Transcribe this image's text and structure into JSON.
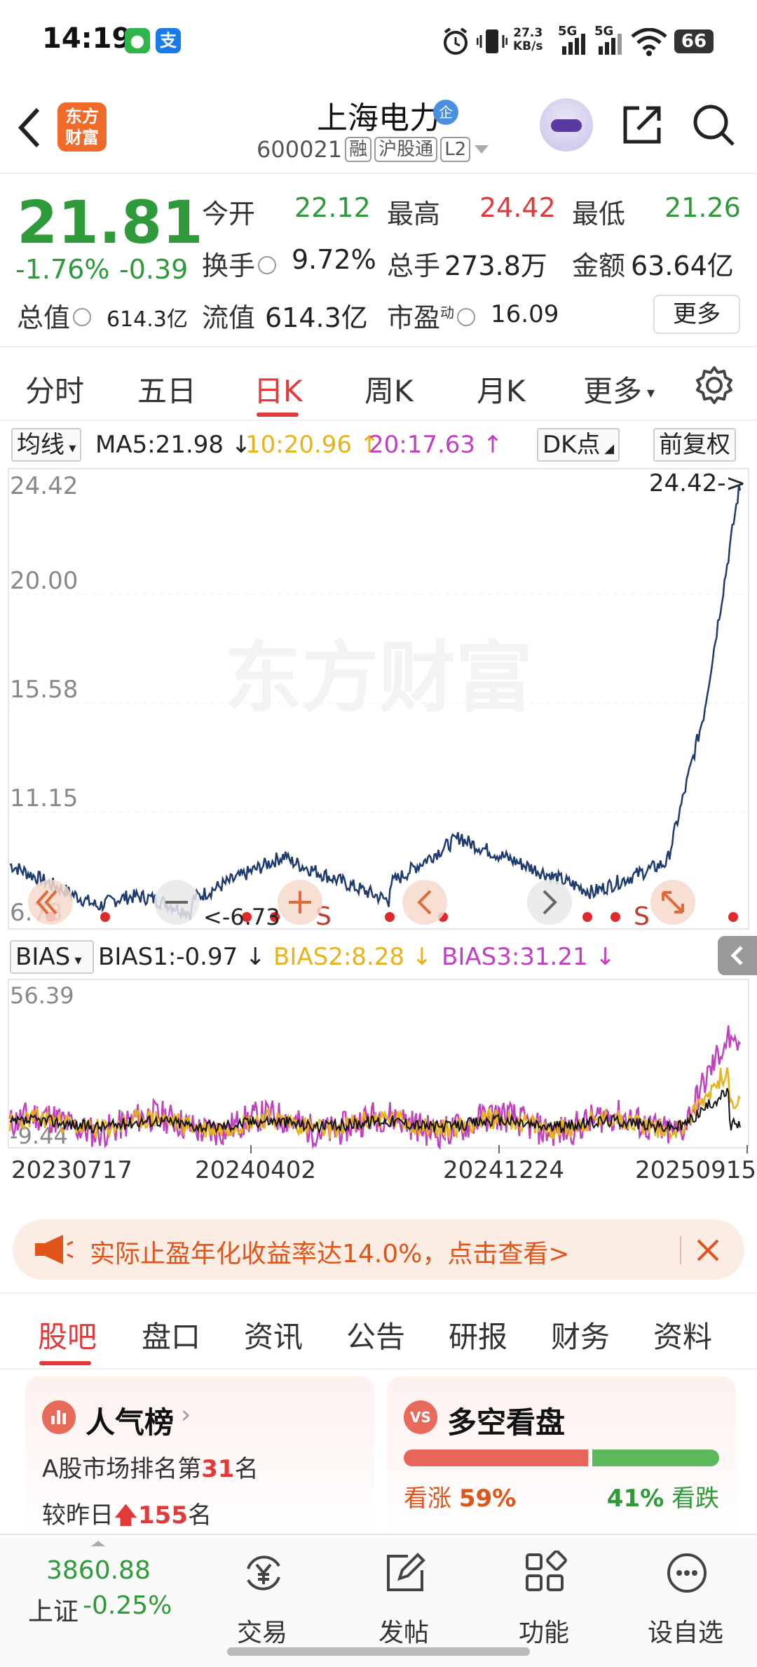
{
  "status_bar": {
    "time": "14:19",
    "app_icons": [
      "wechat-icon",
      "alipay-icon"
    ],
    "net_speed_value": "27.3",
    "net_speed_unit": "KB/s",
    "signal1": "5G",
    "signal2": "5G",
    "battery": "66"
  },
  "header": {
    "brand_logo_line1": "东方",
    "brand_logo_line2": "财富",
    "stock_name": "上海电力",
    "qi_badge": "企",
    "stock_code": "600021",
    "tags": [
      "融",
      "沪股通",
      "L2"
    ]
  },
  "quote": {
    "price": "21.81",
    "change_pct": "-1.76%",
    "change_amt": "-0.39",
    "open_label": "今开",
    "open_value": "22.12",
    "high_label": "最高",
    "high_value": "24.42",
    "low_label": "最低",
    "low_value": "21.26",
    "turnover_label": "换手",
    "turnover_value": "9.72%",
    "volume_label": "总手",
    "volume_value": "273.8万",
    "amount_label": "金额",
    "amount_value": "63.64亿",
    "mktcap_label": "总值",
    "mktcap_value": "614.3亿",
    "float_label": "流值",
    "float_value": "614.3亿",
    "pe_label": "市盈",
    "pe_sup": "动",
    "pe_value": "16.09",
    "more_button": "更多"
  },
  "period_tabs": [
    "分时",
    "五日",
    "日K",
    "周K",
    "月K",
    "更多"
  ],
  "active_period": "日K",
  "ma_row": {
    "selector": "均线",
    "ma5": "MA5:21.98",
    "ma10": "10:20.96",
    "ma20": "20:17.63",
    "dk_button": "DK点",
    "adjust_button": "前复权"
  },
  "kline": {
    "y_labels": [
      "24.42",
      "20.00",
      "15.58",
      "11.15",
      "6.73"
    ],
    "max_marker": "24.42->",
    "min_marker": "<-6.73",
    "signal_labels": [
      "S",
      "S"
    ],
    "watermark": "东方财富"
  },
  "bias_row": {
    "selector": "BIAS",
    "bias1": "BIAS1:-0.97",
    "bias2": "BIAS2:8.28",
    "bias3": "BIAS3:31.21",
    "y_top": "56.39",
    "y_bottom": "-9.44"
  },
  "x_dates": [
    "20230717",
    "20240402",
    "20241224",
    "20250915"
  ],
  "banner": {
    "text": "实际止盈年化收益率达14.0%，点击查看>"
  },
  "section_tabs": [
    "股吧",
    "盘口",
    "资讯",
    "公告",
    "研报",
    "财务",
    "资料"
  ],
  "active_section": "股吧",
  "popularity_card": {
    "icon_label": "",
    "title": "人气榜",
    "rank_prefix": "A股市场排名第",
    "rank_value": "31",
    "rank_suffix": "名",
    "change_prefix": "较昨日",
    "change_value": "155",
    "change_suffix": "名"
  },
  "sentiment_card": {
    "icon_label": "VS",
    "title": "多空看盘",
    "bull_label": "看涨",
    "bull_pct": "59%",
    "bull_fraction": 0.59,
    "bear_label": "看跌",
    "bear_pct": "41%"
  },
  "bottom_nav": {
    "index_value": "3860.88",
    "index_name": "上证",
    "index_change": "-0.25%",
    "items": [
      "交易",
      "发帖",
      "功能",
      "设自选"
    ]
  },
  "colors": {
    "up": "#e23a3a",
    "down": "#2e9a3a",
    "price_line": "#1e3a6e",
    "ma10": "#e8b21a",
    "ma20": "#c040c0",
    "bias1": "#111111",
    "bias2": "#e8b21a",
    "bias3": "#c040c0"
  }
}
